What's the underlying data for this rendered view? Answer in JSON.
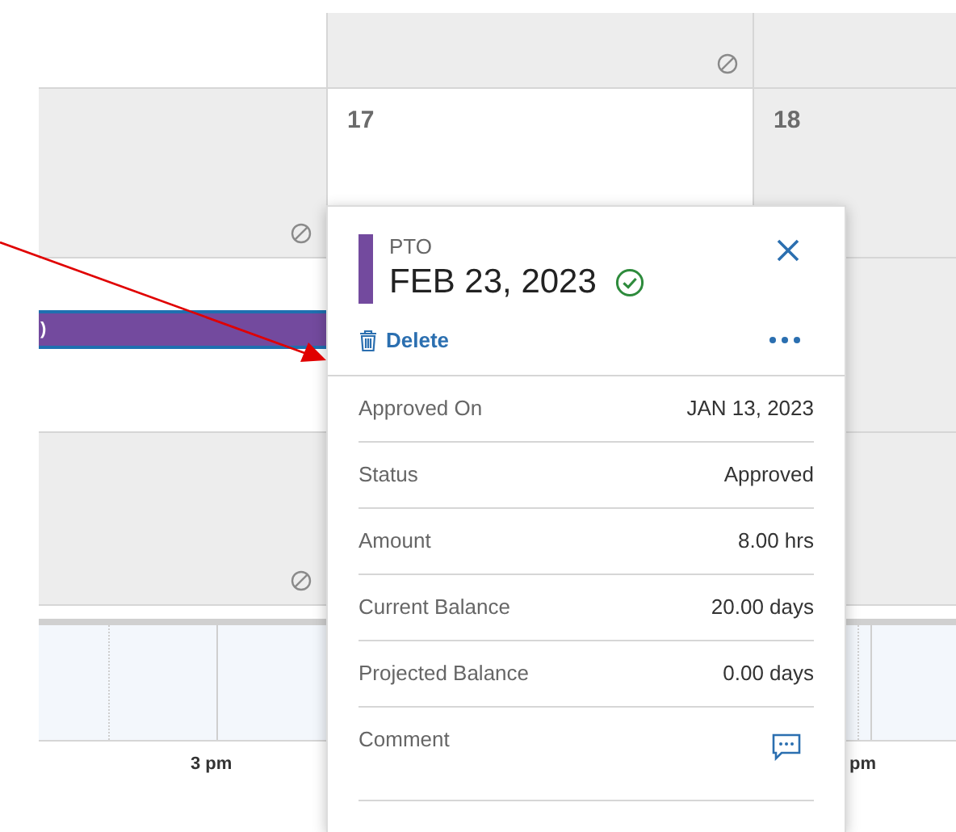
{
  "calendar": {
    "day_numbers": [
      "17",
      "18"
    ],
    "event_bar": {
      "text": ")",
      "color": "#734a9e"
    },
    "time_labels": [
      "3 pm",
      "pm"
    ]
  },
  "popup": {
    "type": "PTO",
    "color": "#734a9e",
    "date": "FEB 23, 2023",
    "approved": true,
    "delete": "Delete",
    "details": [
      {
        "label": "Approved On",
        "value": "JAN 13, 2023"
      },
      {
        "label": "Status",
        "value": "Approved"
      },
      {
        "label": "Amount",
        "value": "8.00 hrs"
      },
      {
        "label": "Current Balance",
        "value": "20.00 days"
      },
      {
        "label": "Projected Balance",
        "value": "0.00 days"
      },
      {
        "label": "Comment",
        "kind": "comment"
      }
    ]
  }
}
